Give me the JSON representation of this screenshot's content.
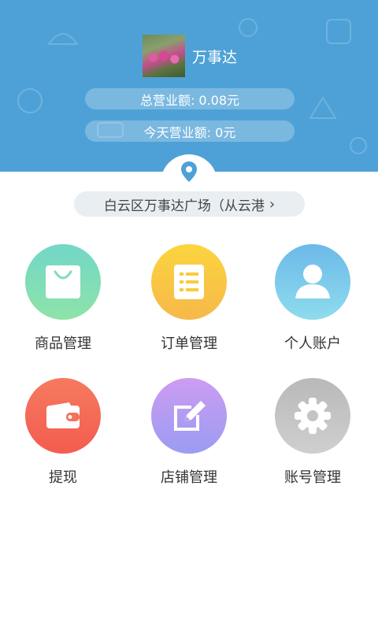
{
  "header": {
    "shop_name": "万事达",
    "total_revenue": "总营业额: 0.08元",
    "today_revenue": "今天营业额: 0元"
  },
  "location": {
    "text": "白云区万事达广场（从云港",
    "chevron": "›"
  },
  "menu": [
    {
      "label": "商品管理",
      "icon": "shopping-bag-icon",
      "color": "#7fdcc0"
    },
    {
      "label": "订单管理",
      "icon": "order-list-icon",
      "color": "#f8cb3c"
    },
    {
      "label": "个人账户",
      "icon": "person-icon",
      "color": "#76c8ea"
    },
    {
      "label": "提现",
      "icon": "wallet-icon",
      "color": "#f5715a"
    },
    {
      "label": "店铺管理",
      "icon": "edit-icon",
      "color": "#b39af0"
    },
    {
      "label": "账号管理",
      "icon": "gear-icon",
      "color": "#c4c4c4"
    }
  ]
}
